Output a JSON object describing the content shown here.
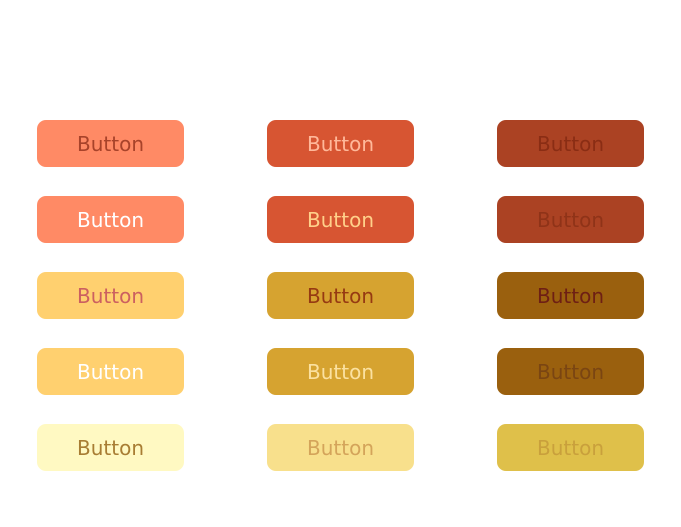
{
  "buttons": [
    [
      {
        "label": "Button",
        "bg": "#FF8A65",
        "fg": "#A8432A"
      },
      {
        "label": "Button",
        "bg": "#D75532",
        "fg": "#FFB89A"
      },
      {
        "label": "Button",
        "bg": "#AB4223",
        "fg": "#8A2D14"
      }
    ],
    [
      {
        "label": "Button",
        "bg": "#FF8A65",
        "fg": "#FFFFFF"
      },
      {
        "label": "Button",
        "bg": "#D75532",
        "fg": "#FFD08A"
      },
      {
        "label": "Button",
        "bg": "#AB4223",
        "fg": "#8F3318"
      }
    ],
    [
      {
        "label": "Button",
        "bg": "#FFD06F",
        "fg": "#CC6060"
      },
      {
        "label": "Button",
        "bg": "#D6A330",
        "fg": "#963A12"
      },
      {
        "label": "Button",
        "bg": "#9A600E",
        "fg": "#6E1F14"
      }
    ],
    [
      {
        "label": "Button",
        "bg": "#FFD06F",
        "fg": "#FFFFFF"
      },
      {
        "label": "Button",
        "bg": "#D6A330",
        "fg": "#FBE1A0"
      },
      {
        "label": "Button",
        "bg": "#9A600E",
        "fg": "#7A4512"
      }
    ],
    [
      {
        "label": "Button",
        "bg": "#FFF9C2",
        "fg": "#A87D33"
      },
      {
        "label": "Button",
        "bg": "#F8E08C",
        "fg": "#D4A45A"
      },
      {
        "label": "Button",
        "bg": "#DFC04A",
        "fg": "#C9A03C"
      }
    ]
  ]
}
